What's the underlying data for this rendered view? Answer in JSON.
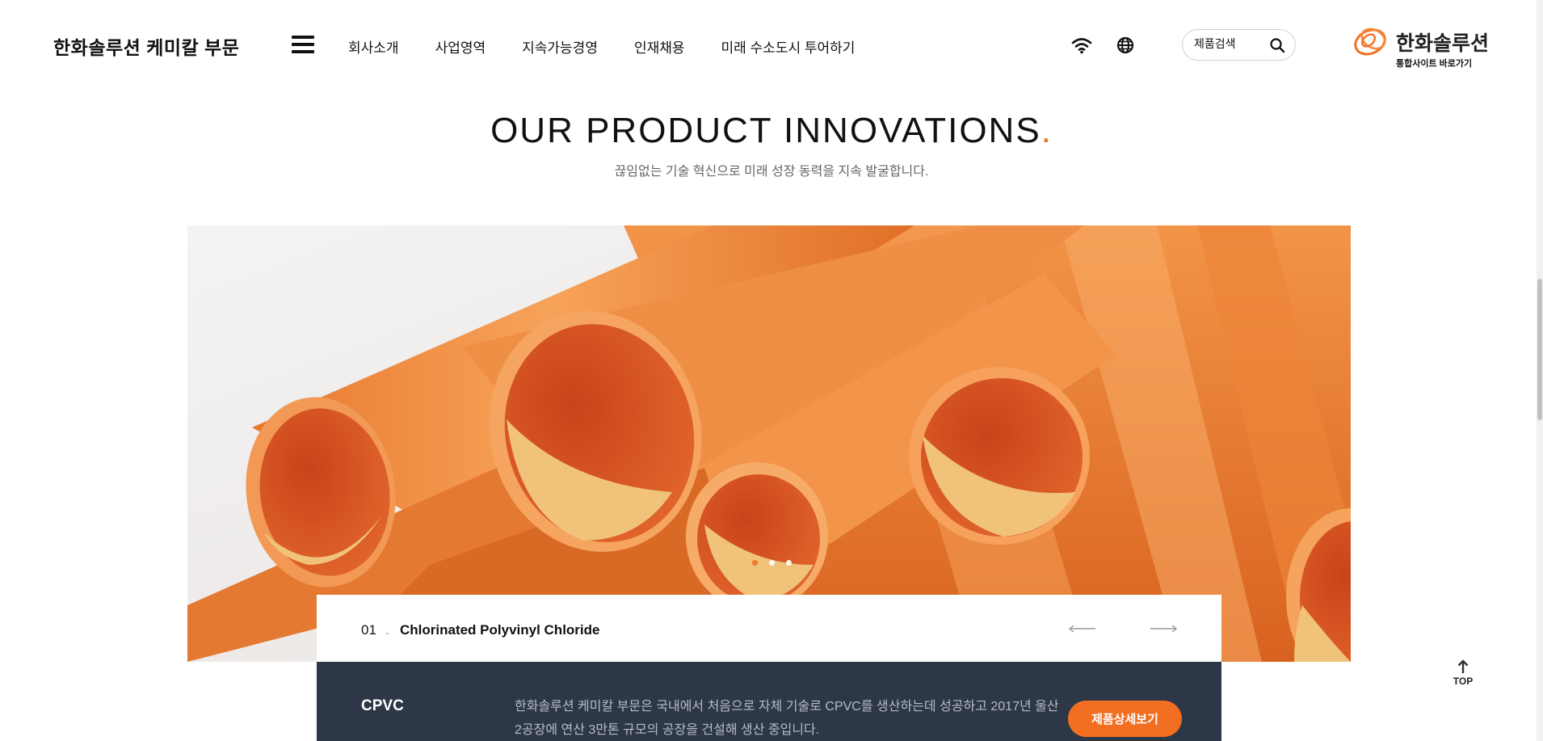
{
  "header": {
    "site_title": "한화솔루션 케미칼 부문",
    "nav": [
      "회사소개",
      "사업영역",
      "지속가능경영",
      "인재채용",
      "미래 수소도시 투어하기"
    ],
    "search_placeholder": "제품검색",
    "brand_name": "한화솔루션",
    "brand_sub": "통합사이트 바로가기"
  },
  "hero": {
    "title": "OUR PRODUCT INNOVATIONS",
    "title_dot": ".",
    "subtitle": "끊임없는 기술 혁신으로 미래 성장 동력을 지속 발굴합니다."
  },
  "slider": {
    "slide_count": 3,
    "active_slide": 1,
    "number": "01",
    "dot": ".",
    "product_title": "Chlorinated Polyvinyl Chloride",
    "product_name": "CPVC",
    "description": "한화솔루션 케미칼 부문은 국내에서 처음으로 자체 기술로 CPVC를 생산하는데 성공하고 2017년 울산 2공장에 연산 3만톤 규모의 공장을 건설해 생산 중입니다.",
    "detail_button": "제품상세보기"
  },
  "top_button": "TOP",
  "colors": {
    "accent": "#f26f21",
    "info_bg": "#2d3748",
    "pipe_orange": "#ee8a3c"
  }
}
